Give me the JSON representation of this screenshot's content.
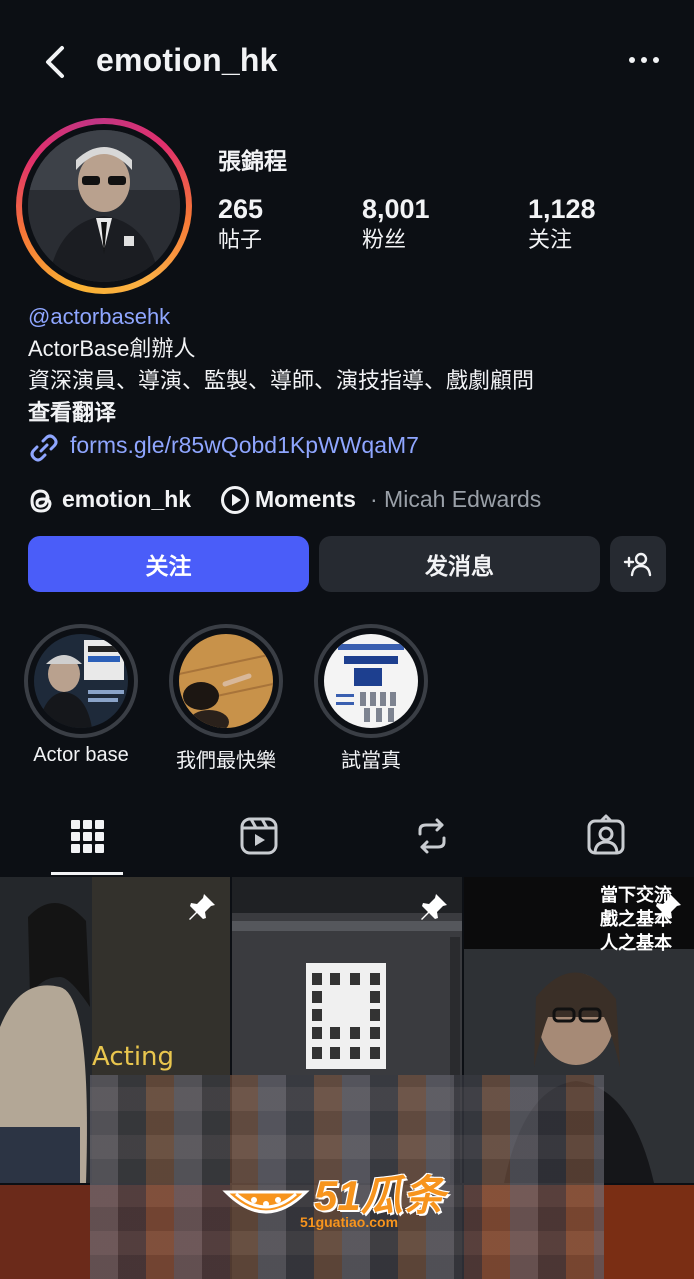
{
  "header": {
    "username": "emotion_hk"
  },
  "profile": {
    "display_name": "張錦程",
    "stats": [
      {
        "value": "265",
        "label": "帖子"
      },
      {
        "value": "8,001",
        "label": "粉丝"
      },
      {
        "value": "1,128",
        "label": "关注"
      }
    ],
    "mention": "@actorbasehk",
    "bio_line1": "ActorBase創辦人",
    "bio_line2": "資深演員、導演、監製、導師、演技指導、戲劇顧問",
    "translate": "查看翻译",
    "link": "forms.gle/r85wQobd1KpWWqaM7",
    "threads_name": "emotion_hk",
    "moments_label": "Moments",
    "moments_sub": "· Micah Edwards"
  },
  "buttons": {
    "follow": "关注",
    "message": "发消息"
  },
  "highlights": [
    {
      "label": "Actor base"
    },
    {
      "label": "我們最快樂"
    },
    {
      "label": "試當真"
    }
  ],
  "grid": {
    "post1_text": "Acting",
    "post3_caption": [
      "當下交流",
      "戲之基本",
      "人之基本"
    ]
  },
  "watermark": {
    "brand": "51瓜条",
    "site": "51guatiao.com"
  },
  "colors": {
    "accent": "#4a5df9",
    "link": "#8fa6ff",
    "background": "#0c0f14"
  }
}
